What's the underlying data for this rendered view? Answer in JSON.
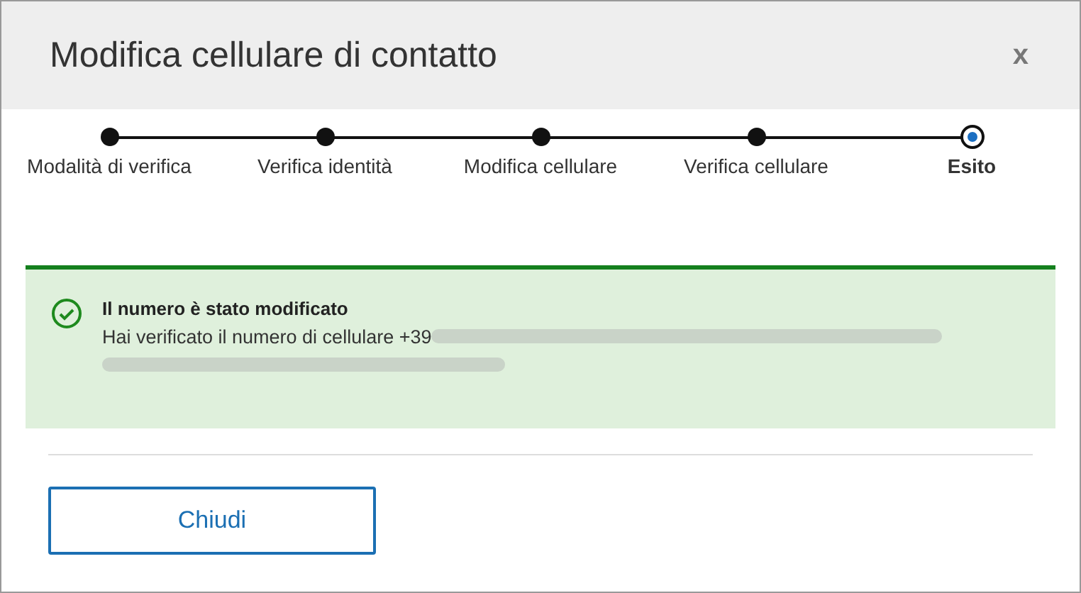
{
  "dialog": {
    "title": "Modifica cellulare di contatto",
    "close": "x"
  },
  "steps": [
    {
      "label": "Modalità di verifica",
      "selected": false
    },
    {
      "label": "Verifica identità",
      "selected": false
    },
    {
      "label": "Modifica cellulare",
      "selected": false
    },
    {
      "label": "Verifica cellulare",
      "selected": false
    },
    {
      "label": "Esito",
      "selected": true
    }
  ],
  "alert": {
    "title": "Il numero è stato modificato",
    "message": "Hai verificato il numero di cellulare +39"
  },
  "buttons": [
    "Chiudi"
  ]
}
